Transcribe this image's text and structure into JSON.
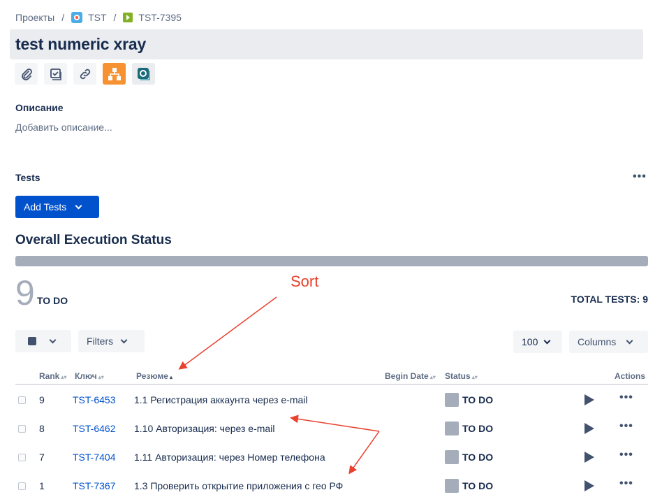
{
  "breadcrumb": {
    "projects": "Проекты",
    "sep1": "/",
    "project": "TST",
    "sep2": "/",
    "issue": "TST-7395"
  },
  "issue": {
    "title": "test numeric xray"
  },
  "action_icons": [
    "attachment-icon",
    "checklist-icon",
    "link-icon",
    "structure-app-icon",
    "xray-app-icon"
  ],
  "description": {
    "label": "Описание",
    "placeholder": "Добавить описание..."
  },
  "tests_section": {
    "label": "Tests",
    "more": "•••",
    "add_button": "Add Tests"
  },
  "execution": {
    "title": "Overall Execution Status",
    "count": "9",
    "status": "TO DO",
    "total_label": "TOTAL TESTS: 9",
    "todo_fraction": 1.0
  },
  "annotation": {
    "sort_label": "Sort",
    "color": "#e8412e"
  },
  "toolbar": {
    "filters": "Filters",
    "page_size": "100",
    "columns": "Columns"
  },
  "table": {
    "headers": {
      "rank": "Rank",
      "key": "Ключ",
      "summary": "Резюме",
      "begin_date": "Begin Date",
      "status": "Status",
      "actions": "Actions"
    },
    "rows": [
      {
        "rank": "9",
        "key": "TST-6453",
        "summary": "1.1 Регистрация аккаунта через e-mail",
        "status": "TO DO"
      },
      {
        "rank": "8",
        "key": "TST-6462",
        "summary": "1.10 Авторизация: через e-mail",
        "status": "TO DO"
      },
      {
        "rank": "7",
        "key": "TST-7404",
        "summary": "1.11 Авторизация: через Номер телефона",
        "status": "TO DO"
      },
      {
        "rank": "1",
        "key": "TST-7367",
        "summary": "1.3 Проверить открытие приложения с гео РФ",
        "status": "TO DO"
      }
    ],
    "row_more": "•••"
  },
  "colors": {
    "primary": "#0052cc",
    "todo_gray": "#a5adba",
    "text": "#172b4d"
  }
}
